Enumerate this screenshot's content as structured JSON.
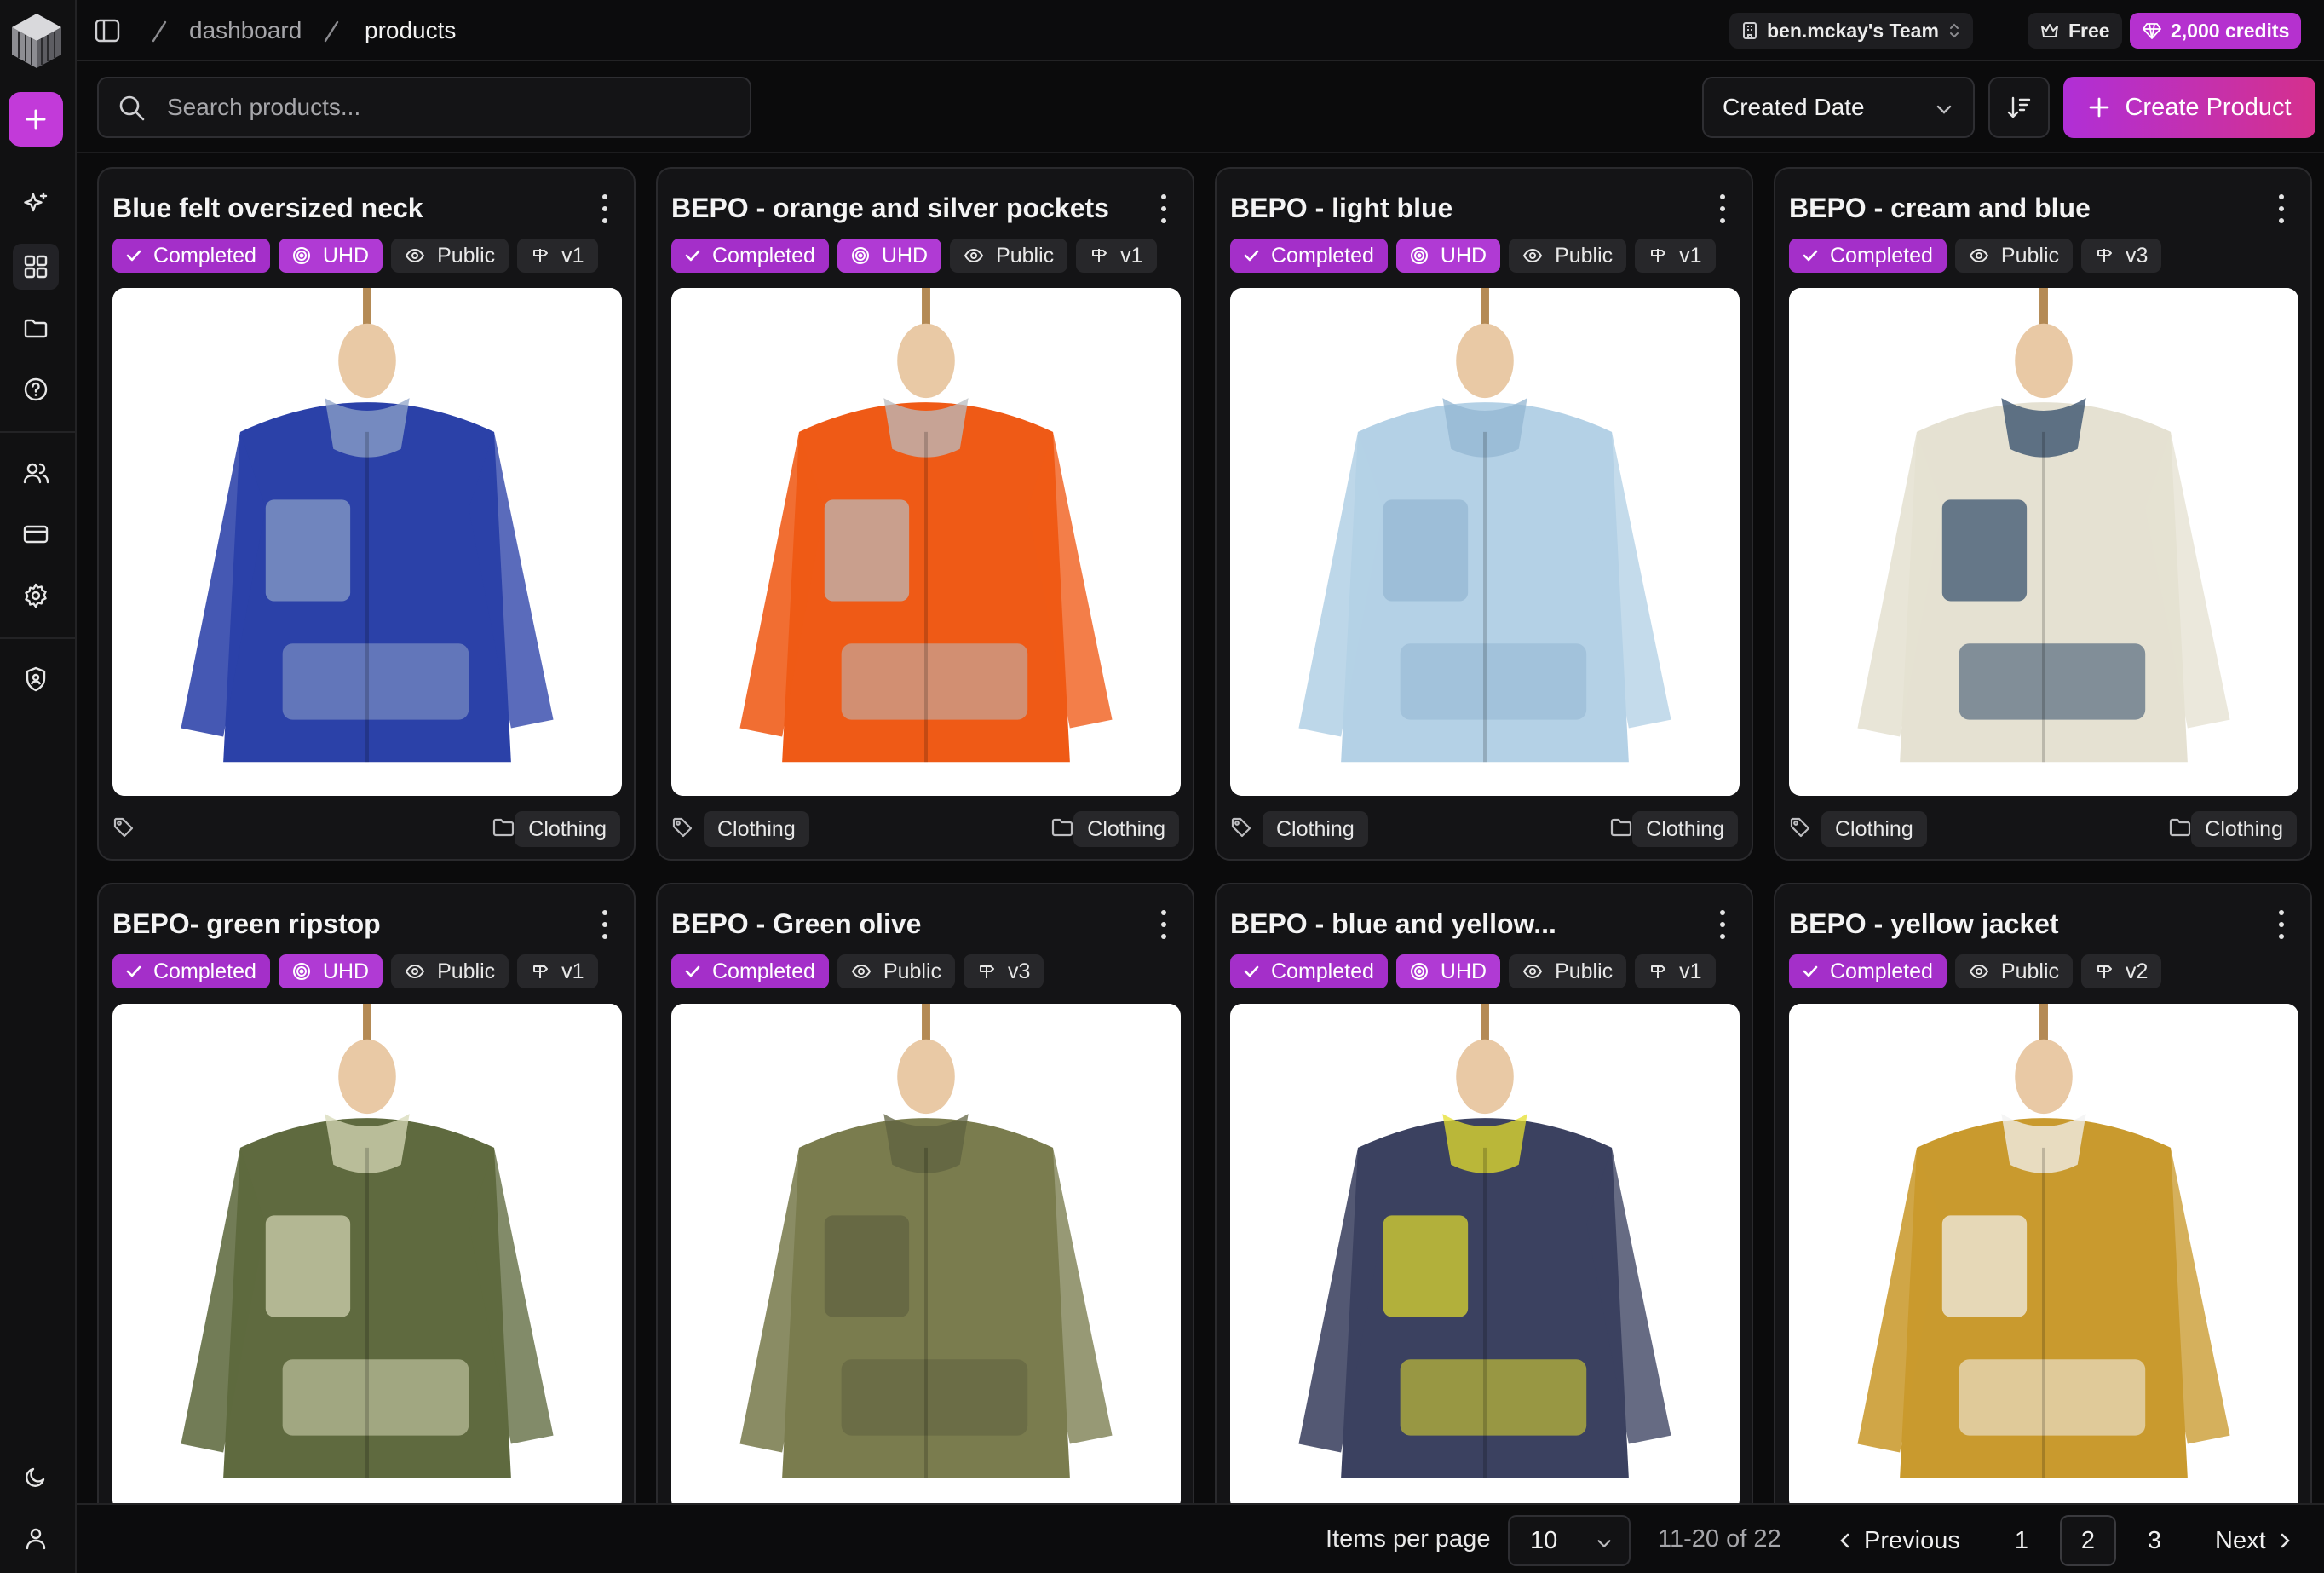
{
  "breadcrumb": {
    "items": [
      "dashboard",
      "products"
    ]
  },
  "topbar": {
    "team": "ben.mckay's Team",
    "plan": "Free",
    "credits": "2,000 credits"
  },
  "search": {
    "placeholder": "Search products..."
  },
  "sort": {
    "selected": "Created Date"
  },
  "create_button": {
    "label": "Create Product"
  },
  "colors": {
    "accent": "#b531cf",
    "create_gradient_end": "#d5308d",
    "badge_completed": "#a42fc9"
  },
  "products": [
    {
      "title": "Blue felt oversized neck",
      "status": "Completed",
      "quality": "UHD",
      "visibility": "Public",
      "version": "v1",
      "tag": "",
      "folder": "Clothing",
      "garment_color": "#2b41a8",
      "garment_accent": "#8fa3c8",
      "image_desc": "blue-felt-top"
    },
    {
      "title": "BEPO - orange and silver pockets",
      "status": "Completed",
      "quality": "UHD",
      "visibility": "Public",
      "version": "v1",
      "tag": "Clothing",
      "folder": "Clothing",
      "garment_color": "#ef5a16",
      "garment_accent": "#b9bcc0",
      "image_desc": "orange-jacket"
    },
    {
      "title": "BEPO - light blue",
      "status": "Completed",
      "quality": "UHD",
      "visibility": "Public",
      "version": "v1",
      "tag": "Clothing",
      "folder": "Clothing",
      "garment_color": "#b4d1e6",
      "garment_accent": "#93b6d2",
      "image_desc": "light-blue-jacket"
    },
    {
      "title": "BEPO - cream and blue",
      "status": "Completed",
      "quality": "",
      "visibility": "Public",
      "version": "v3",
      "tag": "Clothing",
      "folder": "Clothing",
      "garment_color": "#e5e1d2",
      "garment_accent": "#2f4a68",
      "image_desc": "cream-blue-jacket"
    },
    {
      "title": "BEPO- green ripstop",
      "status": "Completed",
      "quality": "UHD",
      "visibility": "Public",
      "version": "v1",
      "tag": "",
      "folder": "",
      "garment_color": "#5f6a3f",
      "garment_accent": "#d7d9b8",
      "image_desc": "green-ripstop-parka"
    },
    {
      "title": "BEPO - Green olive",
      "status": "Completed",
      "quality": "",
      "visibility": "Public",
      "version": "v3",
      "tag": "",
      "folder": "",
      "garment_color": "#7a7c4e",
      "garment_accent": "#5f6140",
      "image_desc": "olive-field-jacket"
    },
    {
      "title": "BEPO - blue and yellow...",
      "status": "Completed",
      "quality": "UHD",
      "visibility": "Public",
      "version": "v1",
      "tag": "",
      "folder": "",
      "garment_color": "#3b4160",
      "garment_accent": "#e6df2c",
      "image_desc": "navy-yellow-anorak"
    },
    {
      "title": "BEPO - yellow jacket",
      "status": "Completed",
      "quality": "",
      "visibility": "Public",
      "version": "v2",
      "tag": "",
      "folder": "",
      "garment_color": "#c99a2e",
      "garment_accent": "#f2f2f2",
      "image_desc": "yellow-jacket"
    }
  ],
  "pagination": {
    "items_per_page_label": "Items per page",
    "items_per_page": "10",
    "range": "11-20 of 22",
    "previous": "Previous",
    "pages": [
      "1",
      "2",
      "3"
    ],
    "current": "2",
    "next": "Next"
  }
}
